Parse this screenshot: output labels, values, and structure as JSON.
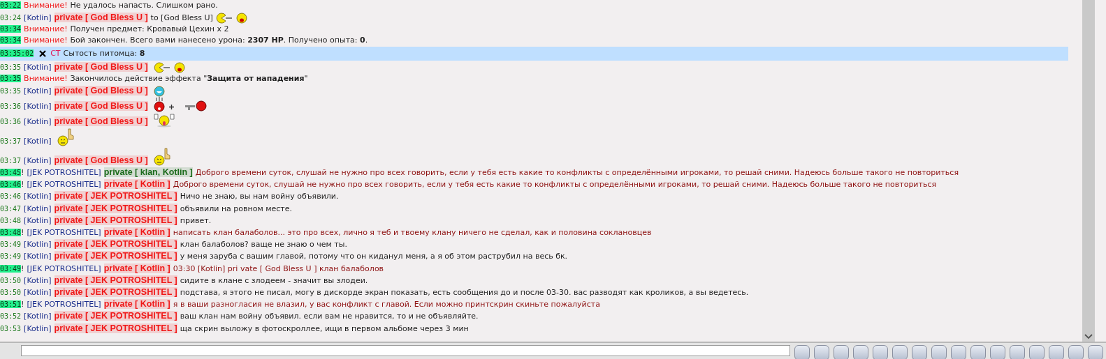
{
  "chat": [
    {
      "kind": "system",
      "time": "03:22",
      "time_highlight": true,
      "label": "Внимание!",
      "text": "Не удалось напасть. Слишком рано."
    },
    {
      "kind": "private",
      "time": "03:24",
      "time_highlight": false,
      "sender": "[Kotlin]",
      "recipient": {
        "text": "private [ God Bless U ]",
        "color": "#f01818"
      },
      "message": {
        "text": "to [God Bless U]",
        "color": "#1e1e1e"
      },
      "emoticons": [
        {
          "kind": "pacman"
        },
        {
          "kind": "crying"
        }
      ]
    },
    {
      "kind": "system",
      "time": "03:34",
      "time_highlight": true,
      "label": "Внимание!",
      "text": "Получен предмет: Кровавый Цехин x 2"
    },
    {
      "kind": "system",
      "time": "03:34",
      "time_highlight": true,
      "label": "Внимание!",
      "text": "Бой закончен. Всего вами нанесено урона: **2307 HP**. Получено опыта: **0**."
    },
    {
      "kind": "pet",
      "time": "03:35:02",
      "time_highlight": true,
      "label": "CT",
      "text": "Сытость питомца: **8**"
    },
    {
      "kind": "private",
      "time": "03:35",
      "time_highlight": false,
      "sender": "[Kotlin]",
      "recipient": {
        "text": "private [ God Bless U ]",
        "color": "#f01818"
      },
      "emoticons": [
        {
          "kind": "pacman"
        },
        {
          "kind": "crying"
        }
      ]
    },
    {
      "kind": "system",
      "time": "03:35",
      "time_highlight": true,
      "label": "Внимание!",
      "text": "Закончилось действие эффекта \"**Защита от нападения**\""
    },
    {
      "kind": "private",
      "time": "03:35",
      "time_highlight": false,
      "sender": "[Kotlin]",
      "recipient": {
        "text": "private [ God Bless U ]",
        "color": "#f01818"
      },
      "emoticons": [
        {
          "kind": "laughing"
        }
      ]
    },
    {
      "kind": "private",
      "time": "03:36",
      "time_highlight": false,
      "sender": "[Kotlin]",
      "recipient": {
        "text": "private [ God Bless U ]",
        "color": "#f01818"
      },
      "emoticons": [
        {
          "kind": "scared"
        },
        {
          "kind": "plus"
        },
        {
          "kind": "gun"
        }
      ]
    },
    {
      "kind": "private",
      "time": "03:36",
      "time_highlight": false,
      "sender": "[Kotlin]",
      "recipient": {
        "text": "private [ God Bless U ]",
        "color": "#f01818"
      },
      "emoticons": [
        {
          "kind": "tongue"
        }
      ]
    },
    {
      "kind": "private",
      "time": "03:37",
      "time_highlight": false,
      "sender": "[Kotlin]",
      "emoticons": [
        {
          "kind": "pointing"
        }
      ]
    },
    {
      "kind": "private",
      "time": "03:37",
      "time_highlight": false,
      "sender": "[Kotlin]",
      "recipient": {
        "text": "private [ God Bless U ]",
        "color": "#f01818"
      },
      "emoticons": [
        {
          "kind": "pointing"
        }
      ]
    },
    {
      "kind": "private",
      "time": "03:45",
      "time_highlight": true,
      "mark": "!",
      "sender": "[JEK POTROSHITEL]",
      "recipient": {
        "text": "private [ klan, Kotlin ]",
        "color": "#1c6b1c"
      },
      "message": {
        "text": "Доброго времени суток, слушай не нужно про всех говорить, если у тебя есть какие то конфликты с определёнными игроками, то решай сними. Надеюсь больше такого не повториться",
        "color": "#8e1212"
      }
    },
    {
      "kind": "private",
      "time": "03:46",
      "time_highlight": true,
      "mark": "!",
      "sender": "[JEK POTROSHITEL]",
      "recipient": {
        "text": "private [ Kotlin ]",
        "color": "#f01818"
      },
      "message": {
        "text": "Доброго времени суток, слушай не нужно про всех говорить, если у тебя есть какие то конфликты с определёнными игроками, то решай сними. Надеюсь больше такого не повториться",
        "color": "#8e1212"
      }
    },
    {
      "kind": "private",
      "time": "03:46",
      "time_highlight": false,
      "sender": "[Kotlin]",
      "recipient": {
        "text": "private [ JEK POTROSHITEL ]",
        "color": "#f01818"
      },
      "message": {
        "text": "Ничо не знаю, вы нам войну объявили.",
        "color": "#1e1e1e"
      }
    },
    {
      "kind": "private",
      "time": "03:47",
      "time_highlight": false,
      "sender": "[Kotlin]",
      "recipient": {
        "text": "private [ JEK POTROSHITEL ]",
        "color": "#f01818"
      },
      "message": {
        "text": "объявили на ровном месте.",
        "color": "#1e1e1e"
      }
    },
    {
      "kind": "private",
      "time": "03:48",
      "time_highlight": false,
      "sender": "[Kotlin]",
      "recipient": {
        "text": "private [ JEK POTROSHITEL ]",
        "color": "#f01818"
      },
      "message": {
        "text": "привет.",
        "color": "#1e1e1e"
      }
    },
    {
      "kind": "private",
      "time": "03:48",
      "time_highlight": true,
      "mark": "!",
      "sender": "[JEK POTROSHITEL]",
      "recipient": {
        "text": "private [ Kotlin ]",
        "color": "#f01818"
      },
      "message": {
        "text": "написать клан балаболов... это про всех, лично я теб и твоему клану ничего не сделал, как и половина соклановцев",
        "color": "#8e1212"
      }
    },
    {
      "kind": "private",
      "time": "03:49",
      "time_highlight": false,
      "sender": "[Kotlin]",
      "recipient": {
        "text": "private [ JEK POTROSHITEL ]",
        "color": "#f01818"
      },
      "message": {
        "text": "клан балаболов? ваще не знаю о чем ты.",
        "color": "#1e1e1e"
      }
    },
    {
      "kind": "private",
      "time": "03:49",
      "time_highlight": false,
      "sender": "[Kotlin]",
      "recipient": {
        "text": "private [ JEK POTROSHITEL ]",
        "color": "#f01818"
      },
      "message": {
        "text": "у меня заруба с вашим главой, потому что он киданул меня, а я об этом раструбил на весь бк.",
        "color": "#1e1e1e"
      }
    },
    {
      "kind": "private",
      "time": "03:49",
      "time_highlight": true,
      "mark": "!",
      "sender": "[JEK POTROSHITEL]",
      "recipient": {
        "text": "private [ Kotlin ]",
        "color": "#f01818"
      },
      "message": {
        "text": "03:30 [Kotlin] pri vate [ God Bless U ] клан балаболов",
        "color": "#8e1212"
      }
    },
    {
      "kind": "private",
      "time": "03:50",
      "time_highlight": false,
      "sender": "[Kotlin]",
      "recipient": {
        "text": "private [ JEK POTROSHITEL ]",
        "color": "#f01818"
      },
      "message": {
        "text": "сидите в клане с злодеем - значит вы злодеи.",
        "color": "#1e1e1e"
      }
    },
    {
      "kind": "private",
      "time": "03:50",
      "time_highlight": false,
      "sender": "[Kotlin]",
      "recipient": {
        "text": "private [ JEK POTROSHITEL ]",
        "color": "#f01818"
      },
      "message": {
        "text": "подстава, я этого не писал, могу в дискорде экран показать, есть сообщения до и после 03-30. вас разводят как кроликов, а вы ведетесь.",
        "color": "#1e1e1e"
      }
    },
    {
      "kind": "private",
      "time": "03:51",
      "time_highlight": true,
      "mark": "!",
      "sender": "[JEK POTROSHITEL]",
      "recipient": {
        "text": "private [ Kotlin ]",
        "color": "#f01818"
      },
      "message": {
        "text": "я в ваши разногласия не влазил, у вас конфликт с главой. Если можно принтскрин скиньте пожалуйста",
        "color": "#8e1212"
      }
    },
    {
      "kind": "private",
      "time": "03:52",
      "time_highlight": false,
      "sender": "[Kotlin]",
      "recipient": {
        "text": "private [ JEK POTROSHITEL ]",
        "color": "#f01818"
      },
      "message": {
        "text": "ваш клан нам войну объявил. если вам не нравится, то и не объявляйте.",
        "color": "#1e1e1e"
      }
    },
    {
      "kind": "private",
      "time": "03:53",
      "time_highlight": false,
      "sender": "[Kotlin]",
      "recipient": {
        "text": "private [ JEK POTROSHITEL ]",
        "color": "#f01818"
      },
      "message": {
        "text": "ща скрин выложу в фотоскроллее, ищи в первом альбоме через 3 мин",
        "color": "#1e1e1e"
      }
    }
  ]
}
